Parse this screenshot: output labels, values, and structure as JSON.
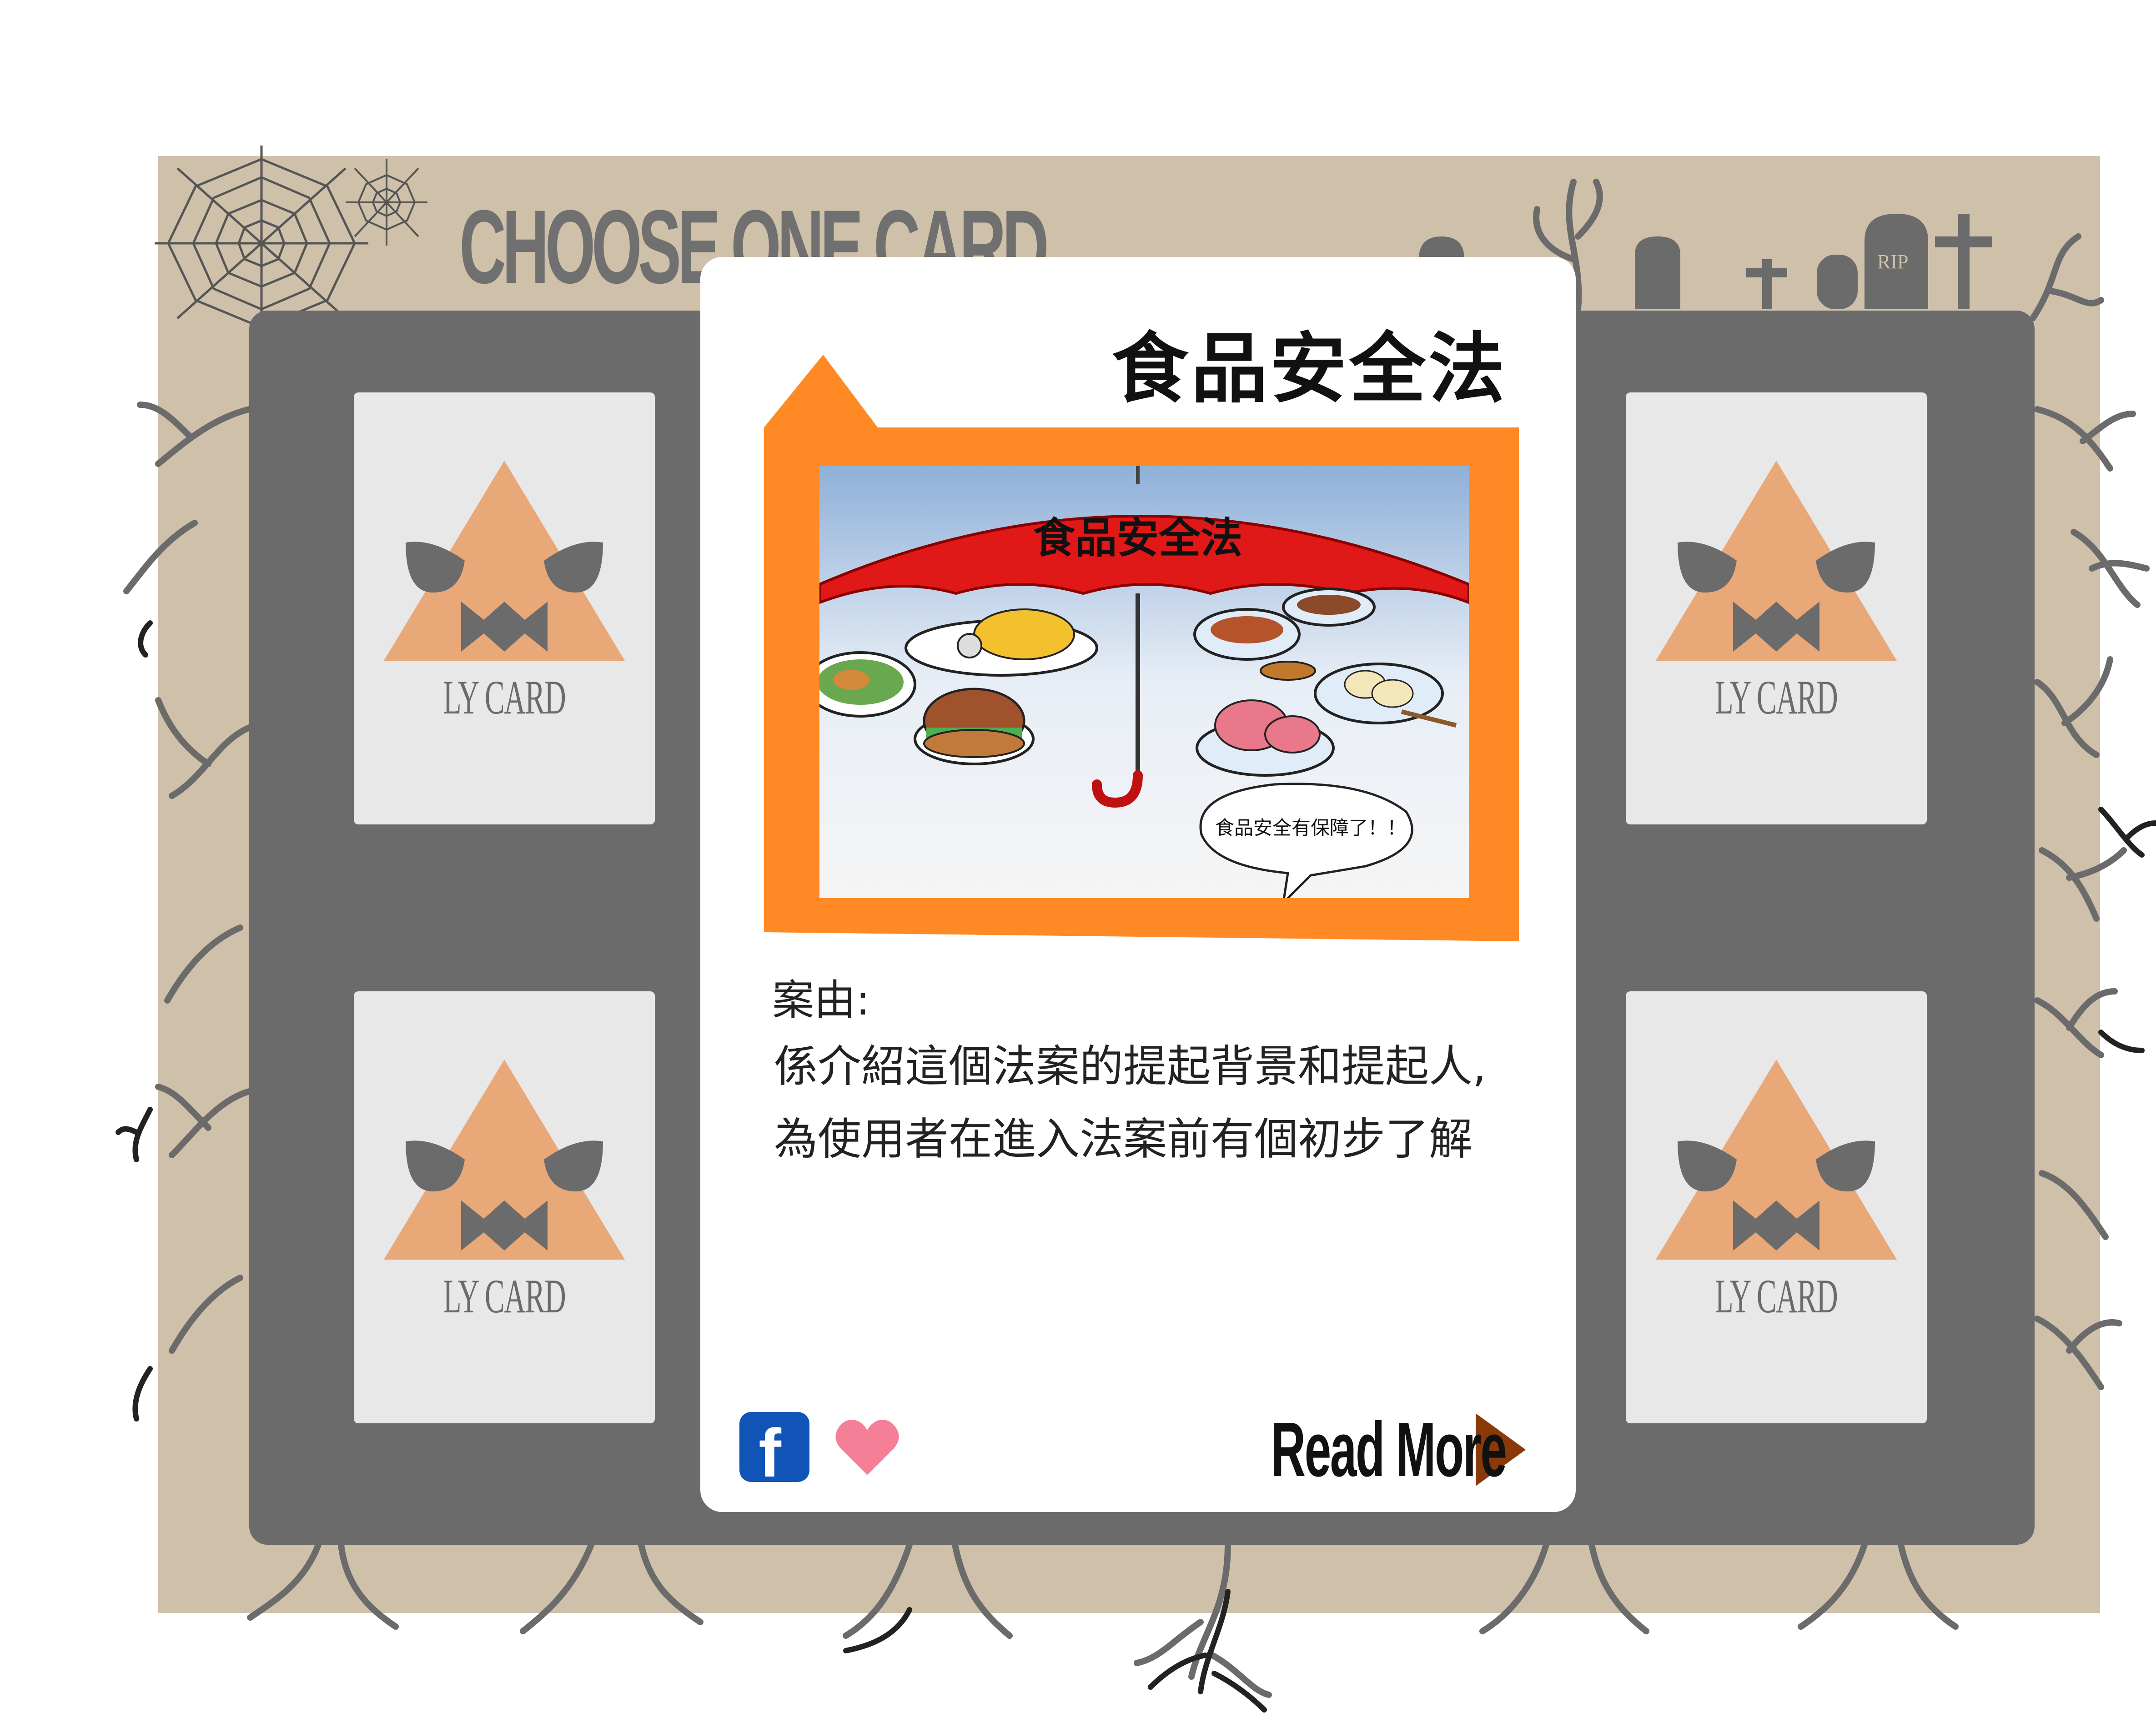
{
  "board": {
    "title": "CHOOSE ONE CARD",
    "card_back_label": "LY CARD",
    "tombstone_text": "RIP"
  },
  "card_slots": [
    {
      "label": "LY CARD"
    },
    {
      "label": "LY CARD"
    },
    {
      "label": "LY CARD"
    },
    {
      "label": "LY CARD"
    }
  ],
  "detail_card": {
    "title": "食品安全法",
    "image": {
      "umbrella_text": "食品安全法",
      "speech_bubble": "食品安全有保障了！！"
    },
    "section_label": "案由:",
    "section_lines": [
      "係介紹這個法案的提起背景和提起人,",
      "為使用者在進入法案前有個初步了解"
    ],
    "facebook_icon": "facebook-icon",
    "like_icon": "heart-icon",
    "read_more_label": "Read More",
    "read_more_icon": "play-triangle-icon"
  },
  "colors": {
    "frame": "#cfc0aa",
    "board": "#6b6b6b",
    "card_face": "#e8e8e8",
    "pumpkin": "#e8a878",
    "orange_accent": "#ff8a25",
    "facebook_blue": "#1154b8",
    "heart_pink": "#f57f96",
    "read_more_arrow": "#8a3a08"
  }
}
